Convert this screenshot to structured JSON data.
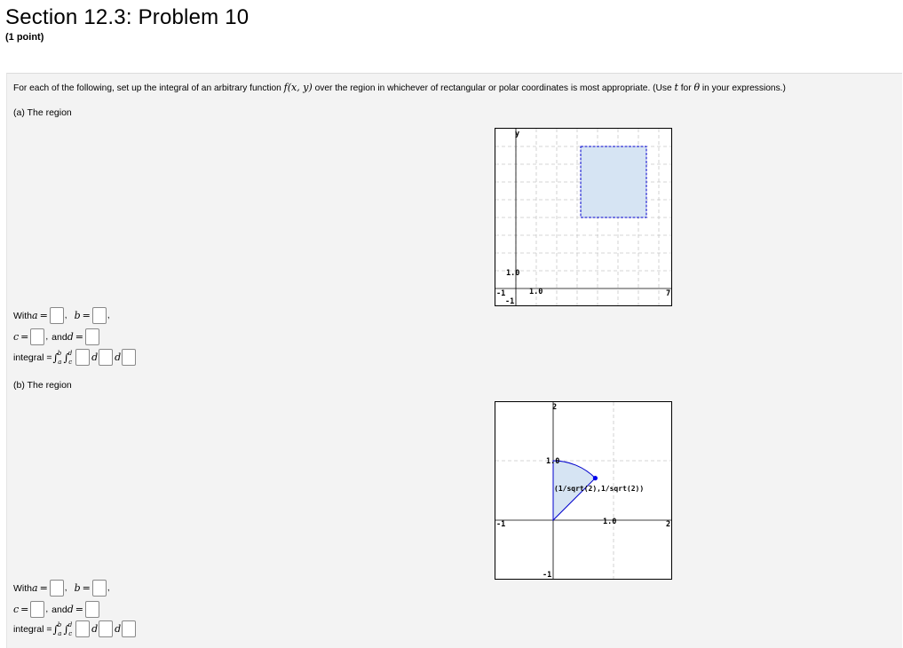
{
  "header": {
    "title": "Section 12.3: Problem 10",
    "points": "(1 point)"
  },
  "intro": {
    "text_before": "For each of the following, set up the integral of an arbitrary function ",
    "func": "f(x, y)",
    "text_middle": " over the region in whichever of rectangular or polar coordinates is most appropriate. (Use ",
    "t": "t",
    "text_for": " for ",
    "theta": "θ",
    "text_after": " in your expressions.)"
  },
  "parts": [
    {
      "label": "(a) The region",
      "graph": {
        "y_axis_label": "y",
        "tick_labels": [
          "1.0",
          "1.0",
          "-1",
          "-1",
          "7"
        ],
        "region_type": "rectangle",
        "region_fill": "#d6e4f3",
        "region_stroke": "#0000cc"
      },
      "form": {
        "with": "With ",
        "a": "a",
        "b": "b",
        "c": "c",
        "and": "and ",
        "d": "d",
        "eq": "=",
        "integral_label": "integral = ",
        "int_upper_outer": "b",
        "int_lower_outer": "a",
        "int_upper_inner": "d",
        "int_lower_inner": "c",
        "d1": "d",
        "d2": "d"
      }
    },
    {
      "label": "(b) The region",
      "graph": {
        "tick_labels": [
          "2",
          "1.0",
          "-1",
          "1.0",
          "2",
          "-1"
        ],
        "point_label": "(1/sqrt(2),1/sqrt(2))",
        "region_type": "sector",
        "region_fill": "#d6e4f3",
        "region_stroke": "#0000cc"
      },
      "form": {
        "with": "With ",
        "a": "a",
        "b": "b",
        "c": "c",
        "and": "and ",
        "d": "d",
        "eq": "=",
        "integral_label": "integral = ",
        "int_upper_outer": "b",
        "int_lower_outer": "a",
        "int_upper_inner": "d",
        "int_lower_inner": "c",
        "d1": "d",
        "d2": "d"
      }
    }
  ]
}
